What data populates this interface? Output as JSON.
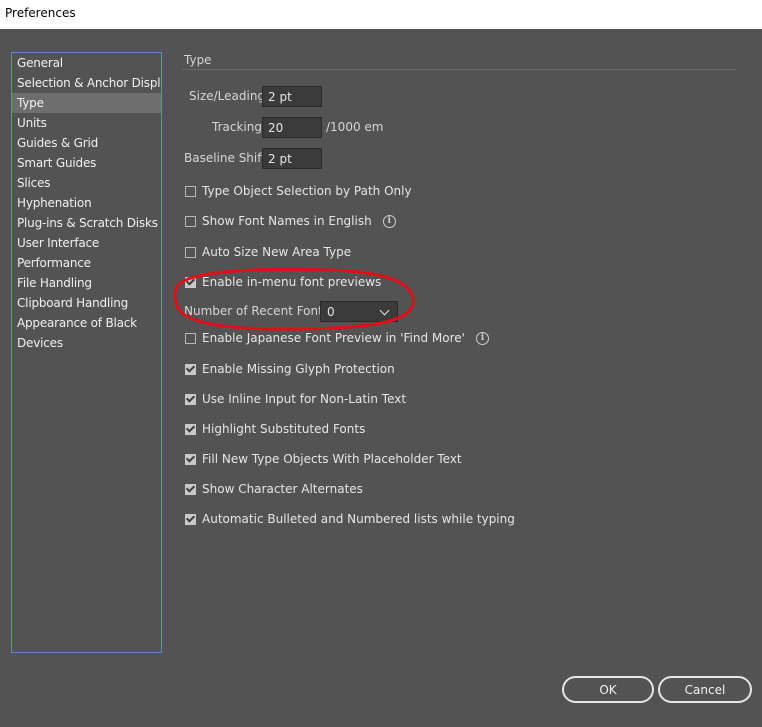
{
  "window": {
    "title": "Preferences"
  },
  "sidebar": {
    "items": [
      {
        "label": "General",
        "active": false
      },
      {
        "label": "Selection & Anchor Display",
        "active": false
      },
      {
        "label": "Type",
        "active": true
      },
      {
        "label": "Units",
        "active": false
      },
      {
        "label": "Guides & Grid",
        "active": false
      },
      {
        "label": "Smart Guides",
        "active": false
      },
      {
        "label": "Slices",
        "active": false
      },
      {
        "label": "Hyphenation",
        "active": false
      },
      {
        "label": "Plug-ins & Scratch Disks",
        "active": false
      },
      {
        "label": "User Interface",
        "active": false
      },
      {
        "label": "Performance",
        "active": false
      },
      {
        "label": "File Handling",
        "active": false
      },
      {
        "label": "Clipboard Handling",
        "active": false
      },
      {
        "label": "Appearance of Black",
        "active": false
      },
      {
        "label": "Devices",
        "active": false
      }
    ]
  },
  "type_panel": {
    "section_title": "Type",
    "size_leading": {
      "label": "Size/Leading:",
      "value": "2 pt"
    },
    "tracking": {
      "label": "Tracking:",
      "value": "20",
      "unit": "/1000 em"
    },
    "baseline_shift": {
      "label": "Baseline Shift:",
      "value": "2 pt"
    },
    "checkboxes": {
      "type_object_selection": {
        "label": "Type Object Selection by Path Only",
        "checked": false
      },
      "show_font_names_english": {
        "label": "Show Font Names in English",
        "checked": false
      },
      "auto_size_area_type": {
        "label": "Auto Size New Area Type",
        "checked": false
      },
      "enable_in_menu_previews": {
        "label": "Enable in-menu font previews",
        "checked": true
      },
      "enable_japanese_preview": {
        "label": "Enable Japanese Font Preview in 'Find More'",
        "checked": false
      },
      "missing_glyph_protection": {
        "label": "Enable Missing Glyph Protection",
        "checked": true
      },
      "inline_input_non_latin": {
        "label": "Use Inline Input for Non-Latin Text",
        "checked": true
      },
      "highlight_substituted": {
        "label": "Highlight Substituted Fonts",
        "checked": true
      },
      "fill_placeholder_text": {
        "label": "Fill New Type Objects With Placeholder Text",
        "checked": true
      },
      "show_character_alternates": {
        "label": "Show Character Alternates",
        "checked": true
      },
      "auto_bulleted_lists": {
        "label": "Automatic Bulleted and Numbered lists while typing",
        "checked": true
      }
    },
    "recent_fonts": {
      "label": "Number of Recent Fonts:",
      "value": "0"
    }
  },
  "buttons": {
    "ok": "OK",
    "cancel": "Cancel"
  },
  "colors": {
    "background": "#535353",
    "sidebar_border": "#5b8dc9",
    "selected_item": "#6e6e6e",
    "annotation": "#e0101a"
  },
  "icons": {
    "info": "info-circle-icon",
    "dropdown": "chevron-down-icon"
  }
}
